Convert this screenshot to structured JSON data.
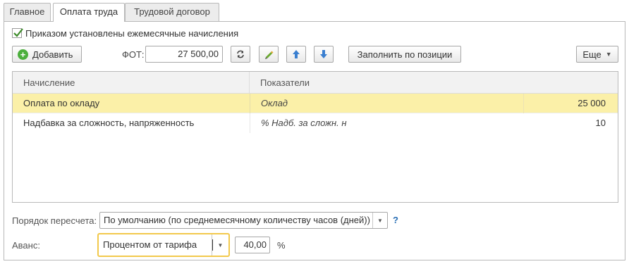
{
  "tabs": [
    {
      "label": "Главное"
    },
    {
      "label": "Оплата труда"
    },
    {
      "label": "Трудовой договор"
    }
  ],
  "checkbox": {
    "label": "Приказом установлены ежемесячные начисления",
    "checked": true
  },
  "toolbar": {
    "add_label": "Добавить",
    "fot_label": "ФОТ:",
    "fot_value": "27 500,00",
    "fill_label": "Заполнить по позиции",
    "more_label": "Еще"
  },
  "table": {
    "headers": [
      "Начисление",
      "Показатели"
    ],
    "rows": [
      {
        "name": "Оплата по окладу",
        "indicator": "Оклад",
        "value": "25 000",
        "selected": true
      },
      {
        "name": "Надбавка за сложность, напряженность",
        "indicator": "%  Надб. за сложн. н",
        "value": "10",
        "selected": false
      }
    ]
  },
  "recalc": {
    "label": "Порядок пересчета:",
    "value": "По умолчанию (по среднемесячному количеству часов (дней))",
    "help": "?"
  },
  "advance": {
    "label": "Аванс:",
    "method": "Процентом от тарифа",
    "value": "40,00",
    "unit": "%"
  },
  "colors": {
    "selected_row": "#fbf0a8",
    "focus_border": "#f2c94c",
    "add_icon": "#4caf3d",
    "arrow_icons": "#3a7fd0"
  }
}
